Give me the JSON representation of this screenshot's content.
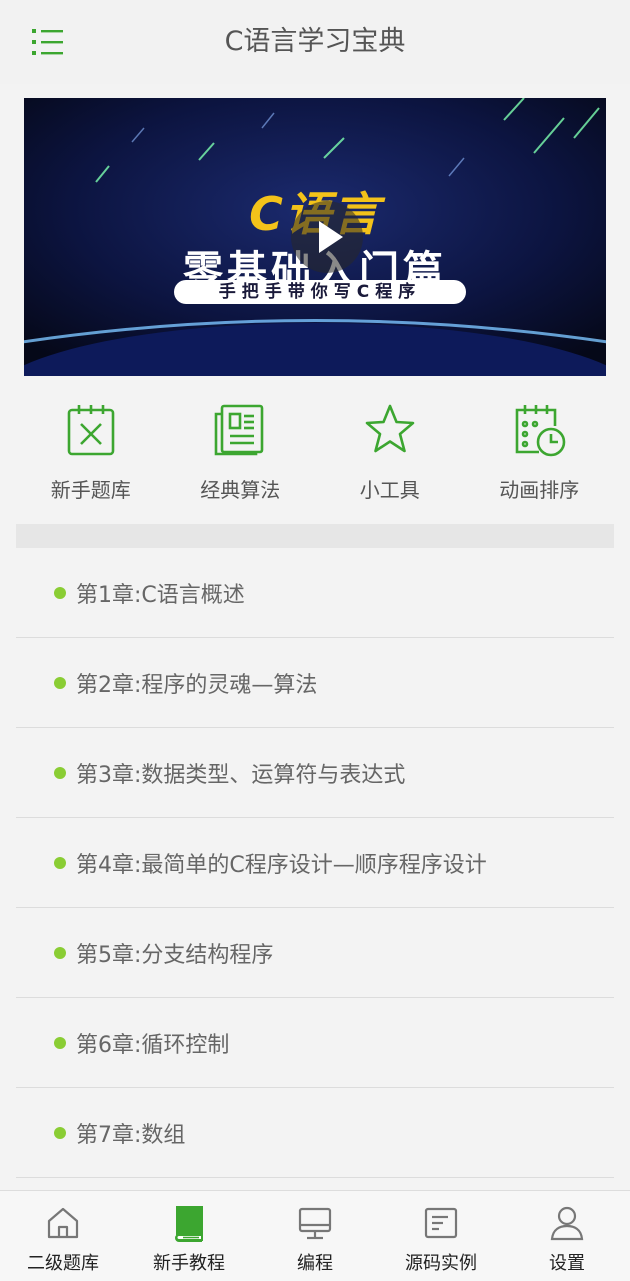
{
  "header": {
    "title": "C语言学习宝典"
  },
  "banner": {
    "brand": "C语言",
    "headline": "零基础入门篇",
    "tagline": "手把手带你写C程序"
  },
  "quick_links": [
    {
      "label": "新手题库",
      "icon": "question-bank-icon"
    },
    {
      "label": "经典算法",
      "icon": "book-icon"
    },
    {
      "label": "小工具",
      "icon": "star-icon"
    },
    {
      "label": "动画排序",
      "icon": "calendar-clock-icon"
    }
  ],
  "chapters": [
    "第1章:C语言概述",
    "第2章:程序的灵魂—算法",
    "第3章:数据类型、运算符与表达式",
    "第4章:最简单的C程序设计—顺序程序设计",
    "第5章:分支结构程序",
    "第6章:循环控制",
    "第7章:数组"
  ],
  "bottom_nav": [
    {
      "label": "二级题库",
      "icon": "home-icon",
      "active": false
    },
    {
      "label": "新手教程",
      "icon": "book-icon",
      "active": true
    },
    {
      "label": "编程",
      "icon": "monitor-icon",
      "active": false
    },
    {
      "label": "源码实例",
      "icon": "document-icon",
      "active": false
    },
    {
      "label": "设置",
      "icon": "user-icon",
      "active": false
    }
  ],
  "colors": {
    "accent": "#3ca630",
    "bullet": "#8acd34",
    "banner_brand": "#f3c21a"
  }
}
